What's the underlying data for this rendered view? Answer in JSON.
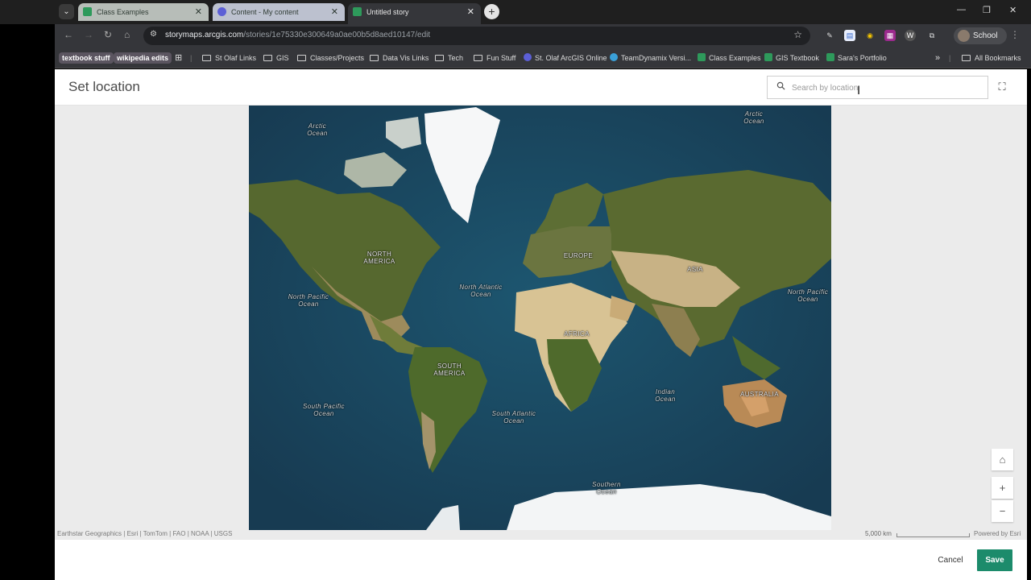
{
  "browser": {
    "tabs": [
      {
        "label": "Class Examples",
        "active": false
      },
      {
        "label": "Content - My content",
        "active": false
      },
      {
        "label": "Untitled story",
        "active": true
      }
    ],
    "url_host": "storymaps.arcgis.com",
    "url_path": "/stories/1e75330e300649a0ae00b5d8aed10147/edit",
    "profile": "School",
    "bookmarks": [
      "textbook stuff",
      "wikipedia edits",
      "St Olaf Links",
      "GIS",
      "Classes/Projects",
      "Data Vis Links",
      "Tech",
      "Fun Stuff",
      "St. Olaf ArcGIS Online",
      "TeamDynamix Versi...",
      "Class Examples",
      "GIS Textbook",
      "Sara's Portfolio",
      "All Bookmarks"
    ]
  },
  "header": {
    "title": "Set location",
    "search_placeholder": "Search by location"
  },
  "map": {
    "labels": {
      "arctic_left": "Arctic Ocean",
      "arctic_right": "Arctic Ocean",
      "north_america": "NORTH AMERICA",
      "europe": "EUROPE",
      "asia": "ASIA",
      "north_pacific_left": "North Pacific Ocean",
      "north_pacific_right": "North Pacific Ocean",
      "north_atlantic": "North Atlantic Ocean",
      "africa": "AFRICA",
      "south_america": "SOUTH AMERICA",
      "indian": "Indian Ocean",
      "australia": "AUSTRALIA",
      "south_pacific": "South Pacific Ocean",
      "south_atlantic": "South Atlantic Ocean",
      "southern": "Southern Ocean"
    },
    "attribution": "Earthstar Geographics | Esri | TomTom | FAO | NOAA | USGS",
    "scale": "5,000 km",
    "powered_by": "Powered by Esri",
    "controls": {
      "home": "⌂",
      "zoom_in": "+",
      "zoom_out": "−"
    }
  },
  "footer": {
    "cancel": "Cancel",
    "save": "Save"
  },
  "colors": {
    "accent": "#1c8b6b",
    "ocean": "#1f4a63",
    "land": "#5c6b34",
    "desert": "#c9ac7a",
    "ice": "#f4f6f7"
  }
}
